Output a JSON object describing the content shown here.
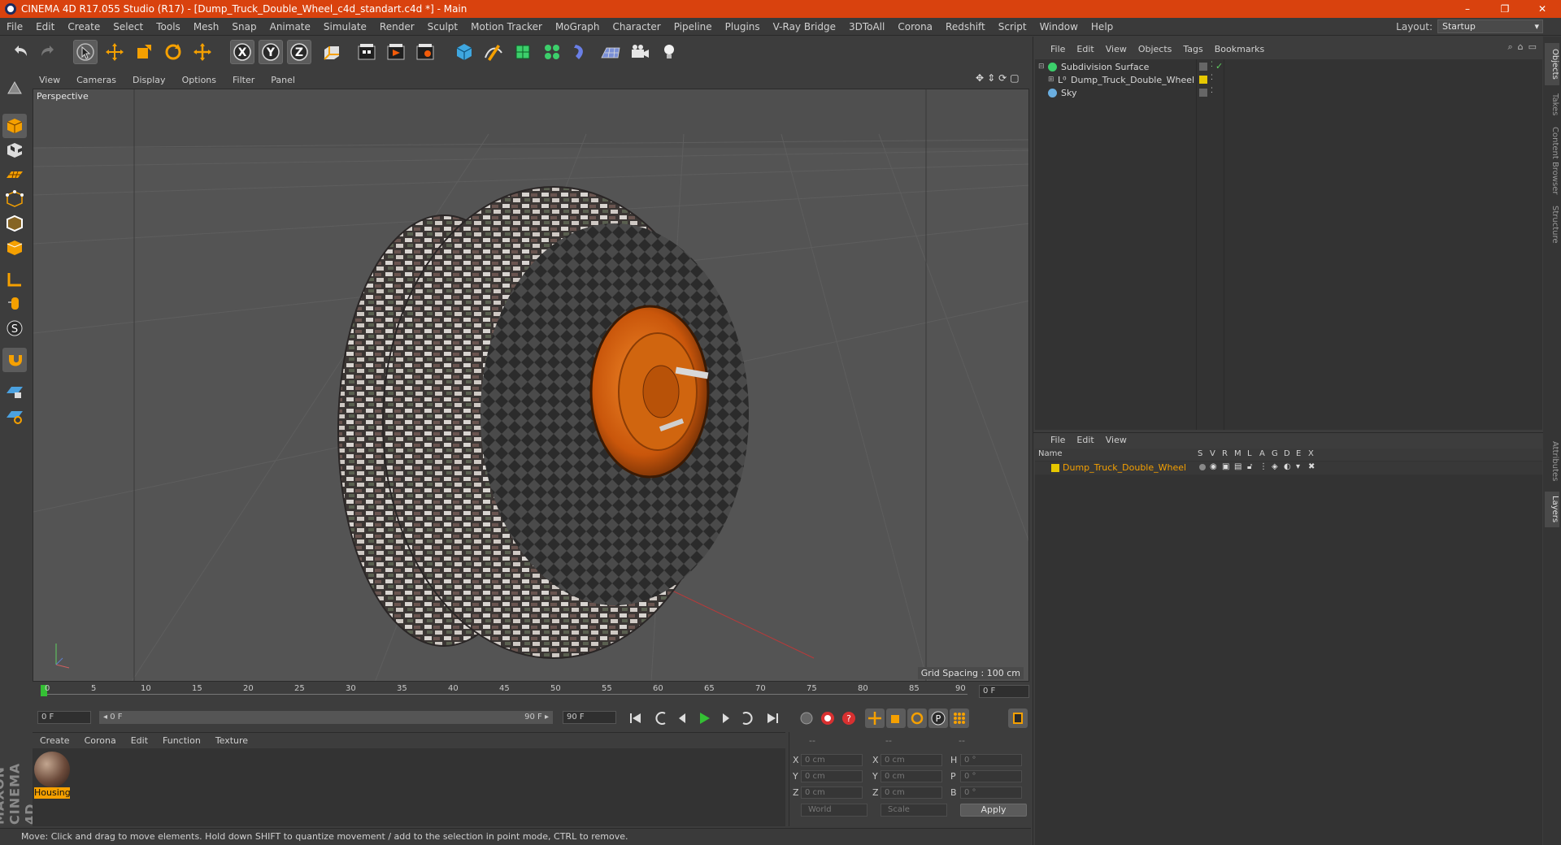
{
  "window": {
    "title": "CINEMA 4D R17.055 Studio (R17) - [Dump_Truck_Double_Wheel_c4d_standart.c4d *] - Main",
    "controls": [
      "–",
      "❐",
      "✕"
    ]
  },
  "menubar": {
    "items": [
      "File",
      "Edit",
      "Create",
      "Select",
      "Tools",
      "Mesh",
      "Snap",
      "Animate",
      "Simulate",
      "Render",
      "Sculpt",
      "Motion Tracker",
      "MoGraph",
      "Character",
      "Pipeline",
      "Plugins",
      "V-Ray Bridge",
      "3DToAll",
      "Corona",
      "Redshift",
      "Script",
      "Window",
      "Help"
    ],
    "layout_label": "Layout:",
    "layout_value": "Startup"
  },
  "toolbar": {
    "icons": [
      "undo-icon",
      "redo-icon",
      "live-selection-icon",
      "move-icon",
      "scale-icon",
      "rotate-icon",
      "recent-tool-icon",
      "x-axis-icon",
      "y-axis-icon",
      "z-axis-icon",
      "coordinate-system-icon",
      "render-view-icon",
      "render-picture-viewer-icon",
      "edit-render-settings-icon",
      "cube-icon",
      "pen-icon",
      "subdivision-icon",
      "cloner-icon",
      "deformer-icon",
      "floor-icon",
      "camera-icon",
      "light-icon"
    ],
    "axis_labels": [
      "X",
      "Y",
      "Z"
    ]
  },
  "left_tools": [
    "make-editable-icon",
    "model-mode-icon",
    "texture-mode-icon",
    "workplane-icon",
    "points-mode-icon",
    "edges-mode-icon",
    "polygons-mode-icon",
    "axis-mode-icon",
    "tweak-icon",
    "solo-icon",
    "snap-icon",
    "lock-workplane-icon",
    "planar-workplane-icon"
  ],
  "viewport": {
    "menu": [
      "View",
      "Cameras",
      "Display",
      "Options",
      "Filter",
      "Panel"
    ],
    "label": "Perspective",
    "grid_spacing": "Grid Spacing : 100 cm"
  },
  "timeline": {
    "ticks": [
      "0",
      "5",
      "10",
      "15",
      "20",
      "25",
      "30",
      "35",
      "40",
      "45",
      "50",
      "55",
      "60",
      "65",
      "70",
      "75",
      "80",
      "85",
      "90"
    ],
    "current_frame": "0 F",
    "start_field": "0 F",
    "range_start": "◂ 0 F",
    "range_end": "90 F ▸",
    "end_field": "90 F"
  },
  "material_manager": {
    "menu": [
      "Create",
      "Corona",
      "Edit",
      "Function",
      "Texture"
    ],
    "materials": [
      {
        "name": "Housing"
      }
    ]
  },
  "coordinates": {
    "headers": [
      "--",
      "--",
      "--"
    ],
    "rows": [
      {
        "a": "X",
        "av": "0 cm",
        "b": "X",
        "bv": "0 cm",
        "c": "H",
        "cv": "0 °"
      },
      {
        "a": "Y",
        "av": "0 cm",
        "b": "Y",
        "bv": "0 cm",
        "c": "P",
        "cv": "0 °"
      },
      {
        "a": "Z",
        "av": "0 cm",
        "b": "Z",
        "bv": "0 cm",
        "c": "B",
        "cv": "0 °"
      }
    ],
    "mode1": "World",
    "mode2": "Scale",
    "apply": "Apply"
  },
  "status": "Move: Click and drag to move elements. Hold down SHIFT to quantize movement / add to the selection in point mode, CTRL to remove.",
  "object_manager": {
    "menu": [
      "File",
      "Edit",
      "View",
      "Objects",
      "Tags",
      "Bookmarks"
    ],
    "objects": [
      "Subdivision Surface",
      "Dump_Truck_Double_Wheel",
      "Sky"
    ]
  },
  "layer_manager": {
    "menu": [
      "File",
      "Edit",
      "View"
    ],
    "columns": [
      "Name",
      "S",
      "V",
      "R",
      "M",
      "L",
      "A",
      "G",
      "D",
      "E",
      "X"
    ],
    "layers": [
      {
        "name": "Dump_Truck_Double_Wheel",
        "color": "#e6c800"
      }
    ]
  },
  "side_tabs": [
    "Objects",
    "Takes",
    "Content Browser",
    "Structure",
    "Attributes",
    "Layers"
  ],
  "colors": {
    "titlebar": "#d9420e",
    "accent_orange": "#f5a000",
    "layer_yellow": "#e6c800",
    "play_green": "#34c034"
  }
}
